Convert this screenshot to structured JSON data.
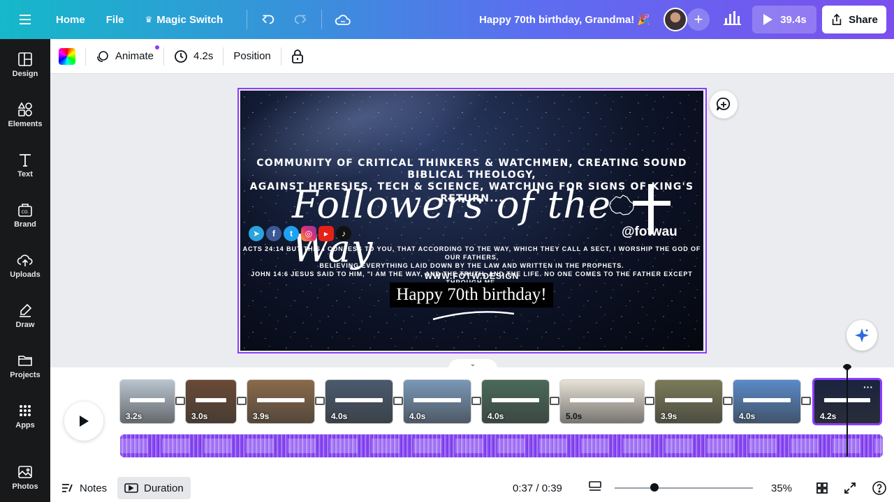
{
  "topbar": {
    "home": "Home",
    "file": "File",
    "magic_switch": "Magic Switch",
    "doc_title": "Happy 70th birthday, Grandma! 🎉",
    "play_time": "39.4s",
    "share": "Share"
  },
  "sidebar": {
    "items": [
      "Design",
      "Elements",
      "Text",
      "Brand",
      "Uploads",
      "Draw",
      "Projects",
      "Apps",
      "Photos"
    ]
  },
  "toolbar2": {
    "animate": "Animate",
    "duration": "4.2s",
    "position": "Position"
  },
  "slide": {
    "community_text": "COMMUNITY OF CRITICAL THINKERS & WATCHMEN, CREATING SOUND BIBLICAL THEOLOGY,\nAGAINST HERESIES,  TECH & SCIENCE, WATCHING FOR SIGNS OF KING'S RETURN...",
    "title": "Followers of the Way",
    "handle": "@fotwau",
    "verse": "ACTS 24:14 BUT THIS I CONFESS TO YOU, THAT ACCORDING TO THE WAY, WHICH THEY CALL A SECT, I WORSHIP THE GOD OF OUR FATHERS,\nBELIEVING EVERYTHING LAID DOWN BY THE LAW AND WRITTEN IN THE PROPHETS.\nJOHN 14:6 JESUS SAID TO HIM, \"I AM THE WAY, AND THE TRUTH, AND THE LIFE. NO ONE COMES TO THE FATHER EXCEPT THROUGH ME.",
    "website": "WWW.FOTW.DESIGN",
    "birthday_text": "Happy 70th birthday!"
  },
  "timeline": {
    "clips": [
      {
        "duration": "3.2s",
        "color": "#b9c4cf"
      },
      {
        "duration": "3.0s",
        "color": "#6a4a36"
      },
      {
        "duration": "3.9s",
        "color": "#8a6a4a"
      },
      {
        "duration": "4.0s",
        "color": "#4a5a6e"
      },
      {
        "duration": "4.0s",
        "color": "#7a98b8"
      },
      {
        "duration": "4.0s",
        "color": "#4a6a5a"
      },
      {
        "duration": "5.0s",
        "color": "#e8e2d6"
      },
      {
        "duration": "3.9s",
        "color": "#7a7a5a"
      },
      {
        "duration": "4.0s",
        "color": "#5a8ac8"
      },
      {
        "duration": "4.2s",
        "color": "#1a2440"
      }
    ]
  },
  "bottom": {
    "notes": "Notes",
    "duration": "Duration",
    "time": "0:37 / 0:39",
    "zoom": "35%",
    "zoom_level": 0.35
  }
}
